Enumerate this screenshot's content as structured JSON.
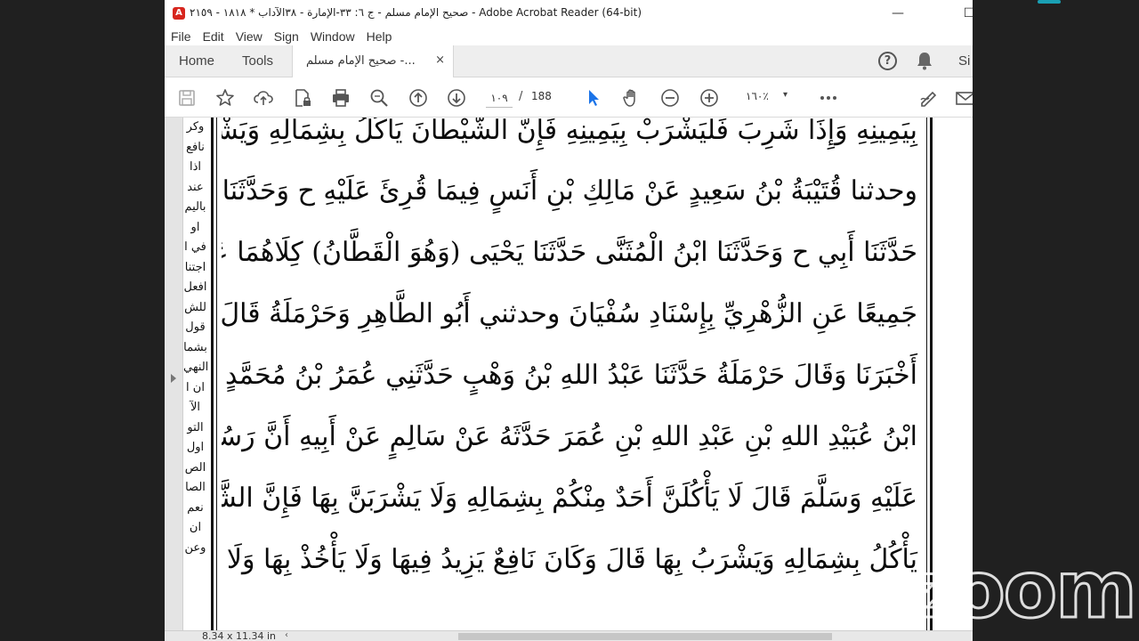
{
  "window": {
    "title": "صحيح الإمام مسلم - ج ٦: ٣٣-الإمارة - ٣٨الآداب * ١٨١٨ - ٢١٥٩ - Adobe Acrobat Reader (64-bit)",
    "minimize": "—",
    "maximize": "☐"
  },
  "menu": [
    "File",
    "Edit",
    "View",
    "Sign",
    "Window",
    "Help"
  ],
  "tabs": {
    "home": "Home",
    "tools": "Tools",
    "document": "صحيح الإمام مسلم -...",
    "close": "×",
    "signin": "Si"
  },
  "toolbar": {
    "current_page": "١٠٩",
    "separator": "/",
    "total_pages": "188",
    "zoom": "١٦٠٪",
    "zoom_arrow": "▾",
    "icons": [
      "save-icon",
      "star-icon",
      "upload-icon",
      "lock-file-icon",
      "print-icon",
      "search-icon",
      "page-up-icon",
      "page-down-icon",
      "cursor-icon",
      "hand-icon",
      "zoom-out-icon",
      "zoom-in-icon",
      "more-icon",
      "sign-icon",
      "email-icon"
    ]
  },
  "page": {
    "margin_words": [
      "وكر",
      "نافع",
      "اذا",
      "عند",
      "باليم",
      "او",
      "في ا",
      "اجتنا",
      "افعل",
      "للش",
      "قول",
      "بشما",
      "النهي",
      "ان ا",
      "الآ",
      "التو",
      "اول",
      "الص",
      "الصا",
      "نعم",
      "ان",
      "وعن"
    ],
    "lines": [
      "بِيَمِينِهِ وَإِذَا شَرِبَ فَلْيَشْرَبْ بِيَمِينِهِ فَإِنَّ الشَّيْطَانَ يَأْكُلُ بِشِمَالِهِ وَيَشْرَبُ بِشِمَالِهِ",
      "وحدثنا قُتَيْبَةُ بْنُ سَعِيدٍ عَنْ مَالِكِ بْنِ أَنَسٍ فِيمَا قُرِئَ عَلَيْهِ ح وَحَدَّثَنَا ابْنُ نُمَيْرٍ",
      "حَدَّثَنَا أَبِي ح وَحَدَّثَنَا ابْنُ الْمُثَنَّى حَدَّثَنَا يَحْيَى (وَهُوَ الْقَطَّانُ) كِلَاهُمَا عَنْ عُبَيْدِ اللهِ",
      "جَمِيعًا عَنِ الزُّهْرِيِّ بِإِسْنَادِ سُفْيَانَ وحدثني أَبُو الطَّاهِرِ وَحَرْمَلَةُ قَالَ أَبُو الطَّاهِرِ",
      "أَخْبَرَنَا وَقَالَ حَرْمَلَةُ حَدَّثَنَا عَبْدُ اللهِ بْنُ وَهْبٍ حَدَّثَنِي عُمَرُ بْنُ مُحَمَّدٍ حَدَّثَنِي الْقَاسِمُ",
      "ابْنُ عُبَيْدِ اللهِ بْنِ عَبْدِ اللهِ بْنِ عُمَرَ حَدَّثَهُ عَنْ سَالِمٍ عَنْ أَبِيهِ أَنَّ رَسُولَ اللهِ صَلَّى اللهُ",
      "عَلَيْهِ وَسَلَّمَ قَالَ لَا يَأْكُلَنَّ أَحَدٌ مِنْكُمْ بِشِمَالِهِ وَلَا يَشْرَبَنَّ بِهَا فَإِنَّ الشَّيْطَانَ",
      "يَأْكُلُ بِشِمَالِهِ وَيَشْرَبُ بِهَا قَالَ وَكَانَ نَافِعٌ يَزِيدُ فِيهَا وَلَا يَأْخُذْ بِهَا وَلَا يُعْطِي"
    ]
  },
  "status": {
    "page_size": "8.34 x 11.34 in",
    "arrow": "‹"
  },
  "overlay": {
    "logo": "zoom"
  }
}
